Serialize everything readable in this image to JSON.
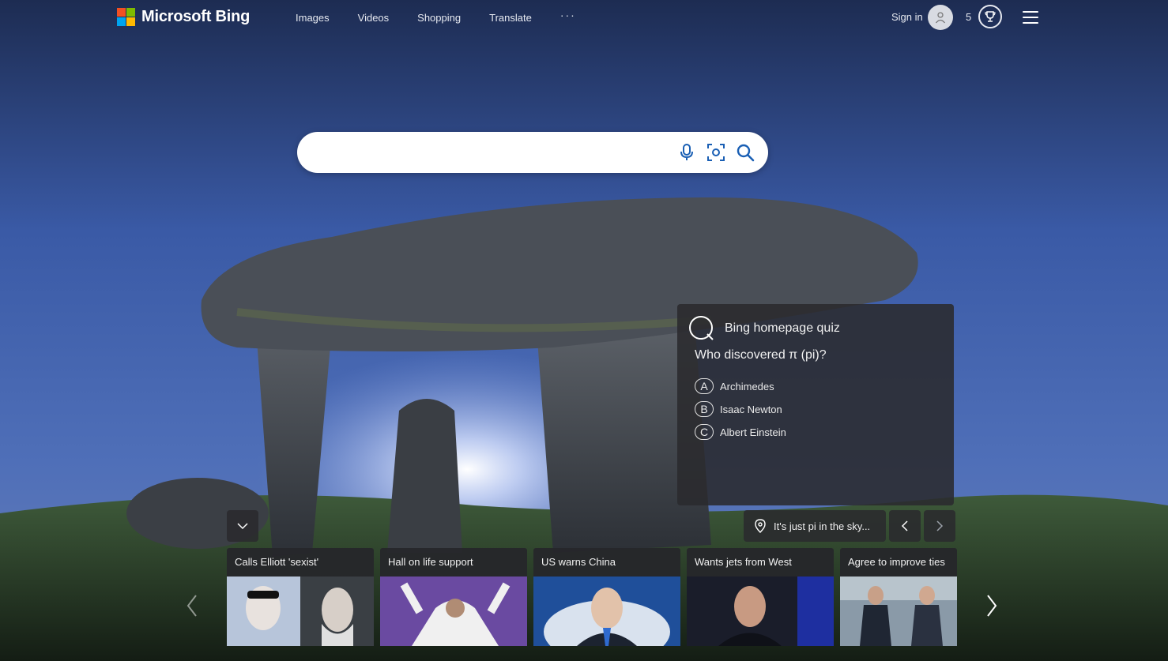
{
  "header": {
    "logo_text": "Microsoft Bing",
    "nav": [
      "Images",
      "Videos",
      "Shopping",
      "Translate"
    ],
    "more_label": "···",
    "signin_label": "Sign in",
    "rewards_count": "5"
  },
  "search": {
    "value": "",
    "placeholder": ""
  },
  "quiz": {
    "title": "Bing homepage quiz",
    "question": "Who discovered π (pi)?",
    "options": [
      {
        "letter": "A",
        "text": "Archimedes"
      },
      {
        "letter": "B",
        "text": "Isaac Newton"
      },
      {
        "letter": "C",
        "text": "Albert Einstein"
      }
    ]
  },
  "image_caption": "It's just pi in the sky...",
  "news": [
    {
      "headline": "Calls Elliott 'sexist'"
    },
    {
      "headline": "Hall on life support"
    },
    {
      "headline": "US warns China"
    },
    {
      "headline": "Wants jets from West"
    },
    {
      "headline": "Agree to improve ties"
    }
  ],
  "colors": {
    "ms_red": "#f25022",
    "ms_green": "#7fba00",
    "ms_blue": "#00a4ef",
    "ms_yellow": "#ffb900",
    "search_icon": "#1a5fb4",
    "panel": "#2a2a2e"
  }
}
